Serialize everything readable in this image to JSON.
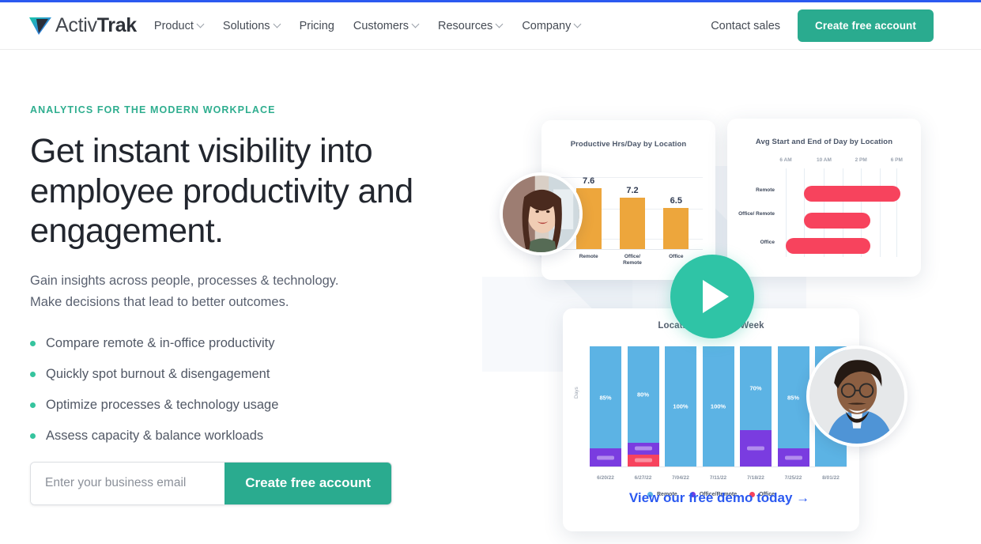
{
  "brand": {
    "logo_activ": "Activ",
    "logo_trak": "Trak",
    "logo_mark_icon": "triangle-arrow-logo-icon",
    "accent_teal": "#2aab8f",
    "accent_blue": "#2b59f0",
    "bullet_green": "#35c49e",
    "bar_orange": "#eda63c",
    "bar_blue": "#5cb3e4",
    "bar_purple": "#7a3ce0",
    "bar_red": "#f7435d",
    "play_teal": "#2fc4a6"
  },
  "header": {
    "nav": [
      {
        "label": "Product",
        "has_chevron": true
      },
      {
        "label": "Solutions",
        "has_chevron": true
      },
      {
        "label": "Pricing",
        "has_chevron": false
      },
      {
        "label": "Customers",
        "has_chevron": true
      },
      {
        "label": "Resources",
        "has_chevron": true
      },
      {
        "label": "Company",
        "has_chevron": true
      }
    ],
    "contact_sales": "Contact sales",
    "cta": "Create free account"
  },
  "hero": {
    "eyebrow": "ANALYTICS FOR THE MODERN WORKPLACE",
    "headline": "Get instant visibility into employee productivity and engagement.",
    "subcopy_line1": "Gain insights across people, processes & technology.",
    "subcopy_line2": "Make decisions that lead to better outcomes.",
    "bullets": [
      "Compare remote & in-office productivity",
      "Quickly spot burnout & disengagement",
      "Optimize processes & technology usage",
      "Assess capacity & balance workloads"
    ],
    "email_placeholder": "Enter your business email",
    "email_value": "",
    "submit_label": "Create free account"
  },
  "visual": {
    "play_button_icon": "play-triangle-icon",
    "photo_a_alt": "smiling-woman-photo",
    "photo_b_alt": "smiling-man-photo",
    "demo_link": "View our free demo today →"
  },
  "chart_data": [
    {
      "type": "bar",
      "title": "Productive Hrs/Day by Location",
      "categories": [
        "Remote",
        "Office/\nRemote",
        "Office"
      ],
      "category_labels": [
        "Remote",
        "Office/ Remote",
        "Office"
      ],
      "values": [
        7.6,
        7.2,
        6.5
      ],
      "value_labels": [
        "7.6",
        "7.2",
        "6.5"
      ],
      "xlabel": "",
      "ylabel": "",
      "ylim": [
        0,
        8
      ],
      "grid": true,
      "color": "#eda63c",
      "legend": null
    },
    {
      "type": "bar",
      "orientation": "horizontal",
      "title": "Avg Start and End of Day by Location",
      "categories": [
        "Remote",
        "Office/ Remote",
        "Office"
      ],
      "x_ticks": [
        "6 AM",
        "10 AM",
        "2 PM",
        "6 PM"
      ],
      "series": [
        {
          "name": "Remote",
          "start": "9:30 AM",
          "end": "6:30 PM"
        },
        {
          "name": "Office/ Remote",
          "start": "9:30 AM",
          "end": "4:00 PM"
        },
        {
          "name": "Office",
          "start": "8:00 AM",
          "end": "4:30 PM"
        }
      ],
      "xlim": [
        "5 AM",
        "8 PM"
      ],
      "grid": true,
      "color": "#f7435d",
      "legend": null
    },
    {
      "type": "bar",
      "stacked": true,
      "title": "Location Trend by Week",
      "ylabel": "Days",
      "categories": [
        "6/20/22",
        "6/27/22",
        "7/04/22",
        "7/11/22",
        "7/18/22",
        "7/25/22",
        "8/01/22"
      ],
      "series": [
        {
          "name": "Remote",
          "color": "#5cb3e4",
          "values": [
            85,
            80,
            100,
            100,
            70,
            85,
            100
          ],
          "value_labels": [
            "85%",
            "80%",
            "100%",
            "100%",
            "70%",
            "85%",
            ""
          ]
        },
        {
          "name": "Office/Remote",
          "color": "#7a3ce0",
          "values": [
            15,
            10,
            0,
            0,
            30,
            15,
            0
          ]
        },
        {
          "name": "Office",
          "color": "#f7435d",
          "values": [
            0,
            10,
            0,
            0,
            0,
            0,
            0
          ]
        }
      ],
      "legend": [
        "Remote",
        "Office/Remote",
        "Office"
      ],
      "legend_position": "bottom",
      "grid": false
    }
  ]
}
